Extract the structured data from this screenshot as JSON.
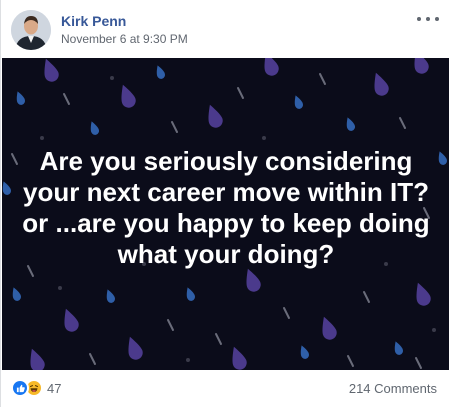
{
  "post": {
    "author": "Kirk Penn",
    "timestamp": "November 6 at 9:30 PM",
    "status_text": "Are you seriously considering your next career move within IT? or ...are you happy to keep doing what your doing?",
    "background_colors": {
      "base": "#0b0c1a",
      "drop_purple": "#4b3a8c",
      "drop_blue": "#2f5fa8",
      "streak": "#6a6c7a"
    }
  },
  "reactions": {
    "icons": [
      "like-icon",
      "haha-icon"
    ],
    "count": "47"
  },
  "comments": {
    "label": "214 Comments"
  }
}
